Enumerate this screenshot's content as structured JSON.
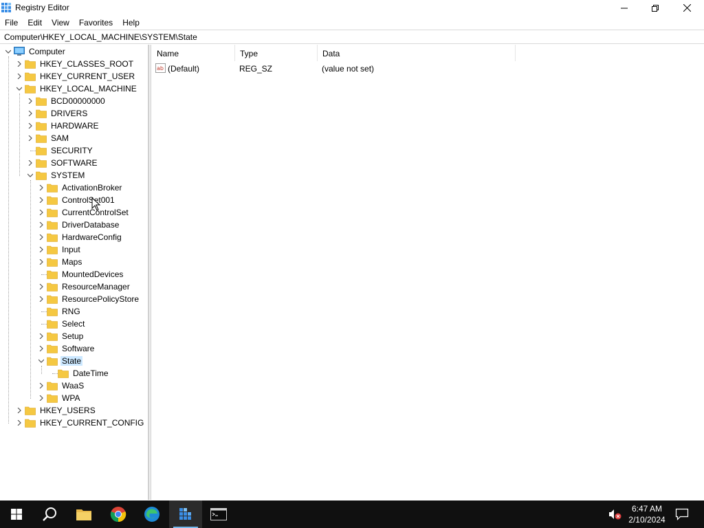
{
  "window": {
    "title": "Registry Editor",
    "minimize_icon": "minimize-icon",
    "maximize_icon": "restore-icon",
    "close_icon": "close-icon"
  },
  "menu": [
    "File",
    "Edit",
    "View",
    "Favorites",
    "Help"
  ],
  "address": "Computer\\HKEY_LOCAL_MACHINE\\SYSTEM\\State",
  "tree": [
    {
      "label": "Computer",
      "level": 0,
      "expander": "expanded",
      "icon": "computer-icon"
    },
    {
      "label": "HKEY_CLASSES_ROOT",
      "level": 1,
      "expander": "collapsed",
      "icon": "folder-icon"
    },
    {
      "label": "HKEY_CURRENT_USER",
      "level": 1,
      "expander": "collapsed",
      "icon": "folder-icon"
    },
    {
      "label": "HKEY_LOCAL_MACHINE",
      "level": 1,
      "expander": "expanded",
      "icon": "folder-icon"
    },
    {
      "label": "BCD00000000",
      "level": 2,
      "expander": "collapsed",
      "icon": "folder-icon"
    },
    {
      "label": "DRIVERS",
      "level": 2,
      "expander": "collapsed",
      "icon": "folder-icon"
    },
    {
      "label": "HARDWARE",
      "level": 2,
      "expander": "collapsed",
      "icon": "folder-icon"
    },
    {
      "label": "SAM",
      "level": 2,
      "expander": "collapsed",
      "icon": "folder-icon"
    },
    {
      "label": "SECURITY",
      "level": 2,
      "expander": "none",
      "icon": "folder-icon"
    },
    {
      "label": "SOFTWARE",
      "level": 2,
      "expander": "collapsed",
      "icon": "folder-icon"
    },
    {
      "label": "SYSTEM",
      "level": 2,
      "expander": "expanded",
      "icon": "folder-icon"
    },
    {
      "label": "ActivationBroker",
      "level": 3,
      "expander": "collapsed",
      "icon": "folder-icon"
    },
    {
      "label": "ControlSet001",
      "level": 3,
      "expander": "collapsed",
      "icon": "folder-icon"
    },
    {
      "label": "CurrentControlSet",
      "level": 3,
      "expander": "collapsed",
      "icon": "folder-icon"
    },
    {
      "label": "DriverDatabase",
      "level": 3,
      "expander": "collapsed",
      "icon": "folder-icon"
    },
    {
      "label": "HardwareConfig",
      "level": 3,
      "expander": "collapsed",
      "icon": "folder-icon"
    },
    {
      "label": "Input",
      "level": 3,
      "expander": "collapsed",
      "icon": "folder-icon"
    },
    {
      "label": "Maps",
      "level": 3,
      "expander": "collapsed",
      "icon": "folder-icon"
    },
    {
      "label": "MountedDevices",
      "level": 3,
      "expander": "none",
      "icon": "folder-icon"
    },
    {
      "label": "ResourceManager",
      "level": 3,
      "expander": "collapsed",
      "icon": "folder-icon"
    },
    {
      "label": "ResourcePolicyStore",
      "level": 3,
      "expander": "collapsed",
      "icon": "folder-icon"
    },
    {
      "label": "RNG",
      "level": 3,
      "expander": "none",
      "icon": "folder-icon"
    },
    {
      "label": "Select",
      "level": 3,
      "expander": "none",
      "icon": "folder-icon"
    },
    {
      "label": "Setup",
      "level": 3,
      "expander": "collapsed",
      "icon": "folder-icon"
    },
    {
      "label": "Software",
      "level": 3,
      "expander": "collapsed",
      "icon": "folder-icon"
    },
    {
      "label": "State",
      "level": 3,
      "expander": "expanded",
      "icon": "folder-icon",
      "selected": true
    },
    {
      "label": "DateTime",
      "level": 4,
      "expander": "none",
      "icon": "folder-icon"
    },
    {
      "label": "WaaS",
      "level": 3,
      "expander": "collapsed",
      "icon": "folder-icon"
    },
    {
      "label": "WPA",
      "level": 3,
      "expander": "collapsed",
      "icon": "folder-icon"
    },
    {
      "label": "HKEY_USERS",
      "level": 1,
      "expander": "collapsed",
      "icon": "folder-icon"
    },
    {
      "label": "HKEY_CURRENT_CONFIG",
      "level": 1,
      "expander": "collapsed",
      "icon": "folder-icon"
    }
  ],
  "list": {
    "columns": {
      "name": "Name",
      "type": "Type",
      "data": "Data"
    },
    "rows": [
      {
        "name": "(Default)",
        "type": "REG_SZ",
        "data": "(value not set)",
        "icon": "string-value-icon"
      }
    ]
  },
  "taskbar": {
    "items": [
      {
        "name": "start-button",
        "icon": "windows-logo-icon"
      },
      {
        "name": "search-button",
        "icon": "search-icon"
      },
      {
        "name": "file-explorer-button",
        "icon": "folder-icon"
      },
      {
        "name": "chrome-button",
        "icon": "chrome-icon"
      },
      {
        "name": "edge-button",
        "icon": "edge-icon"
      },
      {
        "name": "registry-editor-button",
        "icon": "regedit-icon",
        "active": true
      },
      {
        "name": "command-prompt-button",
        "icon": "cmd-icon"
      }
    ],
    "time": "6:47 AM",
    "date": "2/10/2024",
    "volume_icon": "volume-muted-icon",
    "notification_icon": "notification-icon"
  },
  "colors": {
    "selection": "#cce8ff",
    "taskbar": "#101010",
    "folder": "#f5c842",
    "accent": "#76b9ed"
  }
}
